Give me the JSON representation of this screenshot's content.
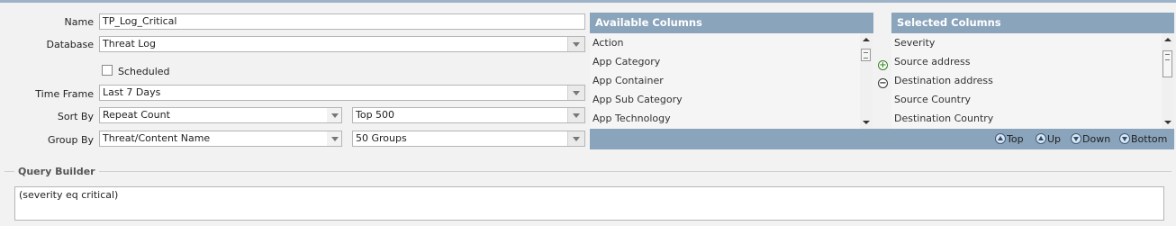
{
  "form": {
    "name": {
      "label": "Name",
      "value": "TP_Log_Critical"
    },
    "database": {
      "label": "Database",
      "value": "Threat Log"
    },
    "scheduled": {
      "label": "Scheduled",
      "checked": false
    },
    "time_frame": {
      "label": "Time Frame",
      "value": "Last 7 Days"
    },
    "sort_by": {
      "label": "Sort By",
      "value": "Repeat Count",
      "limit": "Top 500"
    },
    "group_by": {
      "label": "Group By",
      "value": "Threat/Content Name",
      "limit": "50 Groups"
    }
  },
  "available_columns": {
    "title": "Available Columns",
    "items": [
      "Action",
      "App Category",
      "App Container",
      "App Sub Category",
      "App Technology"
    ]
  },
  "selected_columns": {
    "title": "Selected Columns",
    "items": [
      "Severity",
      "Source address",
      "Destination address",
      "Source Country",
      "Destination Country"
    ]
  },
  "transfer": {
    "add_symbol": "+",
    "remove_symbol": "−"
  },
  "order_buttons": {
    "top": "Top",
    "up": "Up",
    "down": "Down",
    "bottom": "Bottom"
  },
  "query_builder": {
    "title": "Query Builder",
    "query": "(severity eq critical)"
  },
  "colors": {
    "header": "#8aa4bc",
    "top_bar": "#9eb3c8",
    "add_green": "#3a9a2a"
  }
}
